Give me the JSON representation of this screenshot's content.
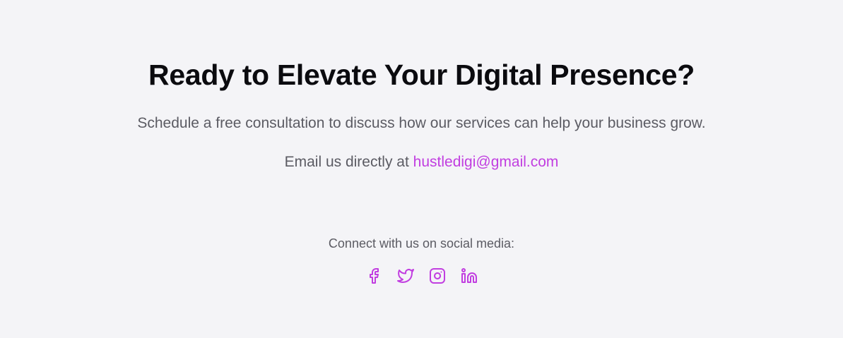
{
  "cta": {
    "title": "Ready to Elevate Your Digital Presence?",
    "subtitle": "Schedule a free consultation to discuss how our services can help your business grow.",
    "email_prefix": "Email us directly at",
    "email": "hustledigi@gmail.com"
  },
  "social": {
    "label": "Connect with us on social media:",
    "icons": [
      "facebook-icon",
      "twitter-icon",
      "instagram-icon",
      "linkedin-icon"
    ]
  },
  "colors": {
    "background": "#f4f4f7",
    "accent": "#c13ee0",
    "heading": "#0b0b0f",
    "body_text": "#5b5b63"
  }
}
